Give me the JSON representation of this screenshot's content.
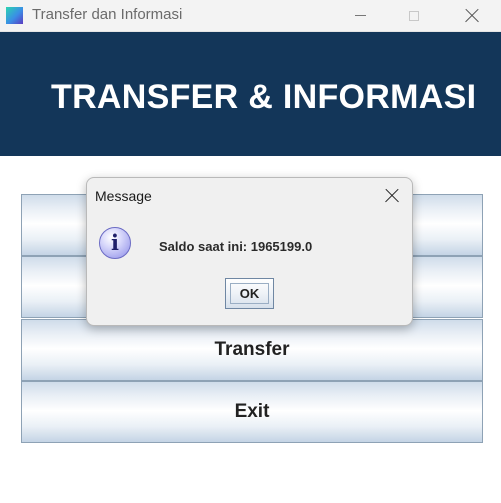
{
  "window": {
    "title": "Transfer dan Informasi",
    "controls": [
      "minimize",
      "maximize",
      "close"
    ]
  },
  "header": {
    "title": "TRANSFER & INFORMASI",
    "background": "#133659"
  },
  "menu": {
    "buttons": [
      {
        "label": ""
      },
      {
        "label": ""
      },
      {
        "label": "Transfer"
      },
      {
        "label": "Exit"
      }
    ]
  },
  "dialog": {
    "title": "Message",
    "icon": "info-icon",
    "icon_glyph": "i",
    "message": "Saldo saat ini: 1965199.0",
    "ok_label": "OK"
  }
}
